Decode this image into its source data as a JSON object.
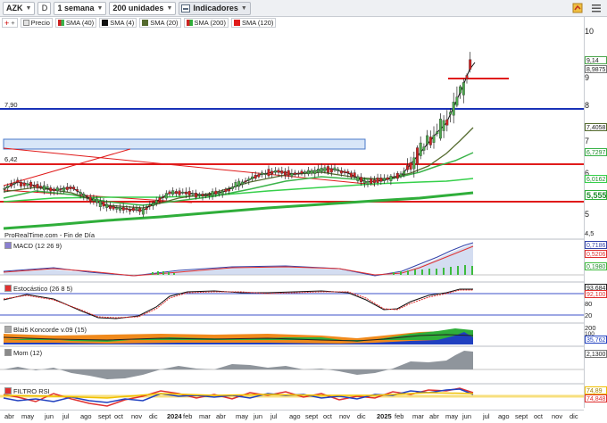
{
  "toolbar": {
    "symbol": "AZK",
    "d_label": "D",
    "period": "1 semana",
    "units": "200 unidades",
    "indicators": "Indicadores"
  },
  "legend": [
    {
      "label": "Precio",
      "color": "#e2e2e2"
    },
    {
      "label": "SMA (40)",
      "color": "#3bb34a"
    },
    {
      "label": "SMA (4)",
      "color": "#111111"
    },
    {
      "label": "SMA (20)",
      "color": "#556b2f"
    },
    {
      "label": "SMA (200)",
      "color": "#2fae3a"
    },
    {
      "label": "SMA (120)",
      "color": "#e01b1b"
    }
  ],
  "price_chart": {
    "labels": {
      "level_high": "7,90",
      "level_low": "6,42",
      "source": "ProRealTime.com - Fin de Día"
    },
    "y_ticks": [
      "10",
      "9",
      "8",
      "7",
      "6",
      "5",
      "4,5"
    ],
    "badges": {
      "last_price": "9,14",
      "sma4": "8,9875",
      "sma20": "7,4058",
      "sma40": "6,7297",
      "sma120": "6,0162",
      "sma200": "5,555"
    },
    "colors": {
      "up": "#4ca64c",
      "down": "#cc2222",
      "support": "#e01b1b",
      "resistance": "#1a33b8"
    }
  },
  "panels": {
    "macd": {
      "title": "MACD (12 26 9)",
      "badges": [
        "0,7186",
        "0,5206",
        "0,1980"
      ]
    },
    "stoch": {
      "title": "Estocástico (26 8 5)",
      "badges": [
        "93,684",
        "92,100"
      ],
      "ticks": [
        "80",
        "20"
      ]
    },
    "blai5": {
      "title": "Blai5 Koncorde v.09 (15)",
      "ticks": [
        "200",
        "100",
        "0"
      ],
      "badges": [
        "35,762"
      ]
    },
    "mom": {
      "title": "Mom (12)",
      "badges": [
        "2,1300"
      ]
    },
    "rsi": {
      "title": "FILTRO RSI",
      "badges": [
        "74,89",
        "74,848"
      ]
    }
  },
  "x_axis": [
    "abr",
    "may",
    "jun",
    "jul",
    "ago",
    "sept",
    "oct",
    "nov",
    "dic",
    "2024",
    "feb",
    "mar",
    "abr",
    "may",
    "jun",
    "jul",
    "ago",
    "sept",
    "oct",
    "nov",
    "dic",
    "2025",
    "feb",
    "mar",
    "abr",
    "may",
    "jun",
    "jul",
    "ago",
    "sept",
    "oct",
    "nov",
    "dic"
  ]
}
